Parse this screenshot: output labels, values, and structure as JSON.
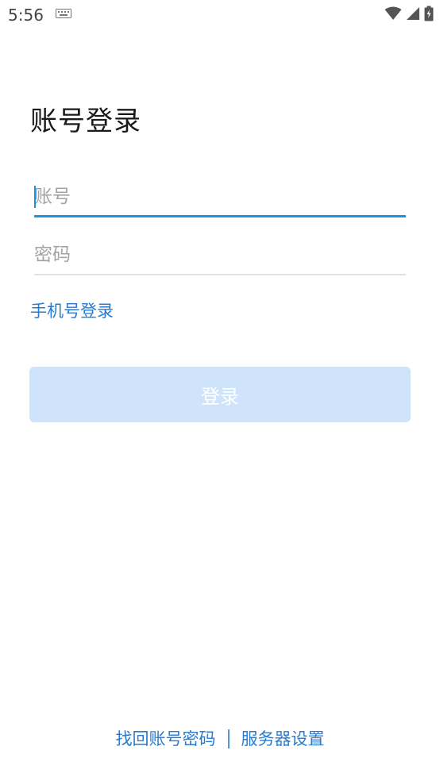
{
  "status_bar": {
    "time": "5:56",
    "icons": [
      "keyboard-icon",
      "wifi-icon",
      "signal-icon",
      "battery-charging-icon"
    ]
  },
  "page": {
    "title": "账号登录"
  },
  "form": {
    "account_placeholder": "账号",
    "account_value": "",
    "password_placeholder": "密码",
    "password_value": "",
    "phone_login_label": "手机号登录",
    "login_button_label": "登录"
  },
  "footer": {
    "recover_label": "找回账号密码",
    "server_settings_label": "服务器设置"
  },
  "colors": {
    "accent": "#1a94e0",
    "link": "#2a7bd0",
    "button_disabled_bg": "#cfe3fa"
  }
}
